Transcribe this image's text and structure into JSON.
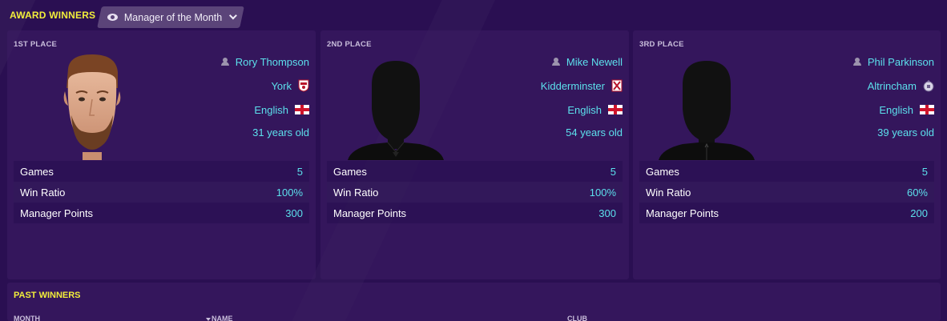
{
  "header": {
    "title": "AWARD WINNERS",
    "view_selector": "Manager of the Month"
  },
  "places": [
    {
      "label": "1ST PLACE",
      "name": "Rory Thompson",
      "club": "York",
      "nationality": "English",
      "age": "31 years old",
      "stats": [
        {
          "label": "Games",
          "value": "5"
        },
        {
          "label": "Win Ratio",
          "value": "100%"
        },
        {
          "label": "Manager Points",
          "value": "300"
        }
      ]
    },
    {
      "label": "2ND PLACE",
      "name": "Mike Newell",
      "club": "Kidderminster",
      "nationality": "English",
      "age": "54 years old",
      "stats": [
        {
          "label": "Games",
          "value": "5"
        },
        {
          "label": "Win Ratio",
          "value": "100%"
        },
        {
          "label": "Manager Points",
          "value": "300"
        }
      ]
    },
    {
      "label": "3RD PLACE",
      "name": "Phil Parkinson",
      "club": "Altrincham",
      "nationality": "English",
      "age": "39 years old",
      "stats": [
        {
          "label": "Games",
          "value": "5"
        },
        {
          "label": "Win Ratio",
          "value": "60%"
        },
        {
          "label": "Manager Points",
          "value": "200"
        }
      ]
    }
  ],
  "past_winners": {
    "title": "PAST WINNERS",
    "columns": [
      "MONTH",
      "NAME",
      "CLUB"
    ]
  },
  "colors": {
    "accent_yellow": "#f2ee3a",
    "value_cyan": "#5ce0ec",
    "background": "#2a0f52"
  }
}
